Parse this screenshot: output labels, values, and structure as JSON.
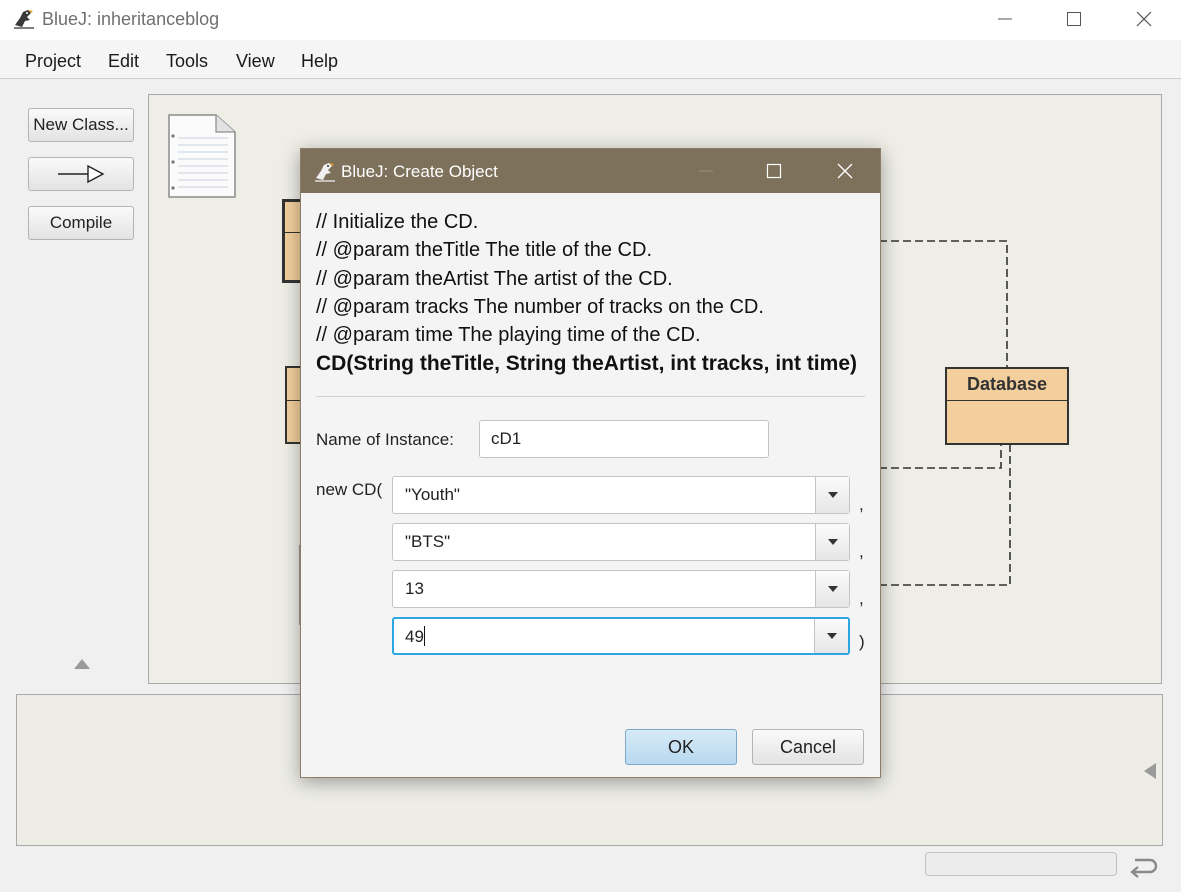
{
  "window": {
    "title": "BlueJ:  inheritanceblog",
    "menu": [
      "Project",
      "Edit",
      "Tools",
      "View",
      "Help"
    ]
  },
  "tools": {
    "new_class": "New Class...",
    "compile": "Compile"
  },
  "diagram": {
    "classes": [
      {
        "name": "Database"
      }
    ]
  },
  "dialog": {
    "title": "BlueJ:  Create Object",
    "comment_lines": [
      "// Initialize the CD.",
      "// @param theTitle The title of the CD.",
      "// @param theArtist The artist of the CD.",
      "// @param tracks The number of tracks on the CD.",
      "// @param time The playing time of the CD."
    ],
    "signature": "CD(String theTitle, String theArtist, int tracks, int time)",
    "instance_label": "Name of Instance:",
    "instance_value": "cD1",
    "constructor_prefix": "new CD(",
    "args": [
      "\"Youth\"",
      "\"BTS\"",
      "13",
      "49"
    ],
    "arg_separator": ",",
    "closing_paren": ")",
    "ok_label": "OK",
    "cancel_label": "Cancel"
  }
}
